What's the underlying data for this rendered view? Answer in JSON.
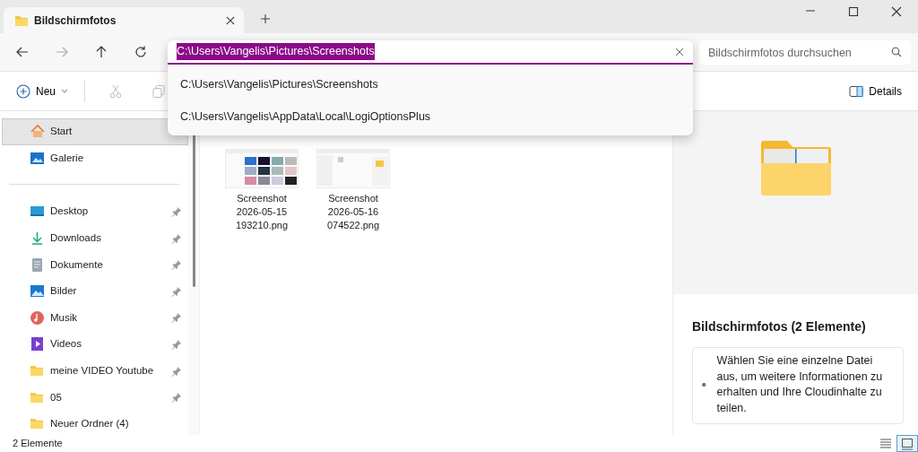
{
  "window": {
    "tab_title": "Bildschirmfotos"
  },
  "address": {
    "value": "C:\\Users\\Vangelis\\Pictures\\Screenshots",
    "selected": true,
    "suggestions": [
      "C:\\Users\\Vangelis\\Pictures\\Screenshots",
      "C:\\Users\\Vangelis\\AppData\\Local\\LogiOptionsPlus"
    ]
  },
  "search": {
    "placeholder": "Bildschirmfotos durchsuchen"
  },
  "toolbar": {
    "new_label": "Neu",
    "details_label": "Details"
  },
  "sidebar": {
    "sections": [
      {
        "items": [
          {
            "label": "Start",
            "kind": "home",
            "pinned": false,
            "selected": true
          },
          {
            "label": "Galerie",
            "kind": "gallery",
            "pinned": false,
            "selected": false
          }
        ]
      },
      {
        "items": [
          {
            "label": "Desktop",
            "kind": "desktop",
            "pinned": true,
            "selected": false
          },
          {
            "label": "Downloads",
            "kind": "downloads",
            "pinned": true,
            "selected": false
          },
          {
            "label": "Dokumente",
            "kind": "documents",
            "pinned": true,
            "selected": false
          },
          {
            "label": "Bilder",
            "kind": "pictures",
            "pinned": true,
            "selected": false
          },
          {
            "label": "Musik",
            "kind": "music",
            "pinned": true,
            "selected": false
          },
          {
            "label": "Videos",
            "kind": "videos",
            "pinned": true,
            "selected": false
          },
          {
            "label": "meine VIDEO Youtube",
            "kind": "folder",
            "pinned": true,
            "selected": false
          },
          {
            "label": "05",
            "kind": "folder",
            "pinned": true,
            "selected": false
          },
          {
            "label": "Neuer Ordner (4)",
            "kind": "folder",
            "pinned": false,
            "selected": false
          }
        ]
      }
    ]
  },
  "files": [
    {
      "name": "Screenshot 2026-05-15 193210.png",
      "kind": "grid"
    },
    {
      "name": "Screenshot 2026-05-16 074522.png",
      "kind": "window"
    }
  ],
  "details": {
    "title": "Bildschirmfotos (2 Elemente)",
    "info": "Wählen Sie eine einzelne Datei aus, um weitere Informationen zu erhalten und Ihre Cloudinhalte zu teilen."
  },
  "status_bar": {
    "count": "2 Elemente",
    "views": [
      {
        "kind": "list",
        "selected": false
      },
      {
        "kind": "tiles",
        "selected": true
      }
    ]
  }
}
